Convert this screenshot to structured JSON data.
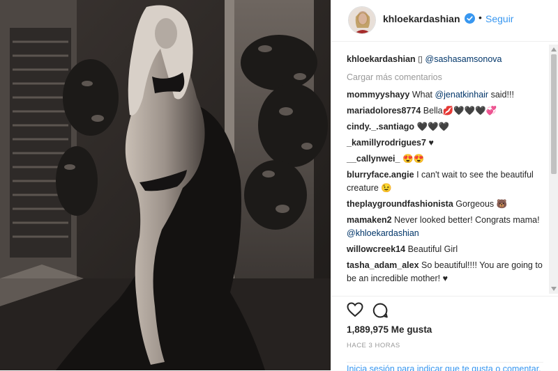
{
  "header": {
    "username": "khloekardashian",
    "dot": "•",
    "follow_label": "Seguir"
  },
  "caption": {
    "username": "khloekardashian",
    "glyph": "▯",
    "mention": "@sashasamsonova"
  },
  "load_more": "Cargar más comentarios",
  "comments": [
    {
      "user": "mommyyshayy",
      "pre": "What ",
      "mention": "@jenatkinhair",
      "post": " said!!!"
    },
    {
      "user": "mariadolores8774",
      "pre": "Bella💋🖤🖤🖤💞",
      "mention": "",
      "post": ""
    },
    {
      "user": "cindy._.santiago",
      "pre": "🖤🖤🖤",
      "mention": "",
      "post": ""
    },
    {
      "user": "_kamillyrodrigues7",
      "pre": "♥",
      "mention": "",
      "post": ""
    },
    {
      "user": "__callynwei_",
      "pre": "😍😍",
      "mention": "",
      "post": ""
    },
    {
      "user": "blurryface.angie",
      "pre": "I can't wait to see the beautiful creature 😉",
      "mention": "",
      "post": ""
    },
    {
      "user": "theplaygroundfashionista",
      "pre": "Gorgeous 🐻",
      "mention": "",
      "post": ""
    },
    {
      "user": "mamaken2",
      "pre": "Never looked better! Congrats mama! ",
      "mention": "@khloekardashian",
      "post": ""
    },
    {
      "user": "willowcreek14",
      "pre": "Beautiful Girl",
      "mention": "",
      "post": ""
    },
    {
      "user": "tasha_adam_alex",
      "pre": "So beautiful!!!! You are going to be an incredible mother! ♥",
      "mention": "",
      "post": ""
    }
  ],
  "likes": "1,889,975 Me gusta",
  "time": "HACE 3 HORAS",
  "add_comment": "Inicia sesión para indicar que te gusta o comentar.",
  "colors": {
    "link": "#3897f0",
    "verified": "#3897f0",
    "mention": "#003569"
  }
}
